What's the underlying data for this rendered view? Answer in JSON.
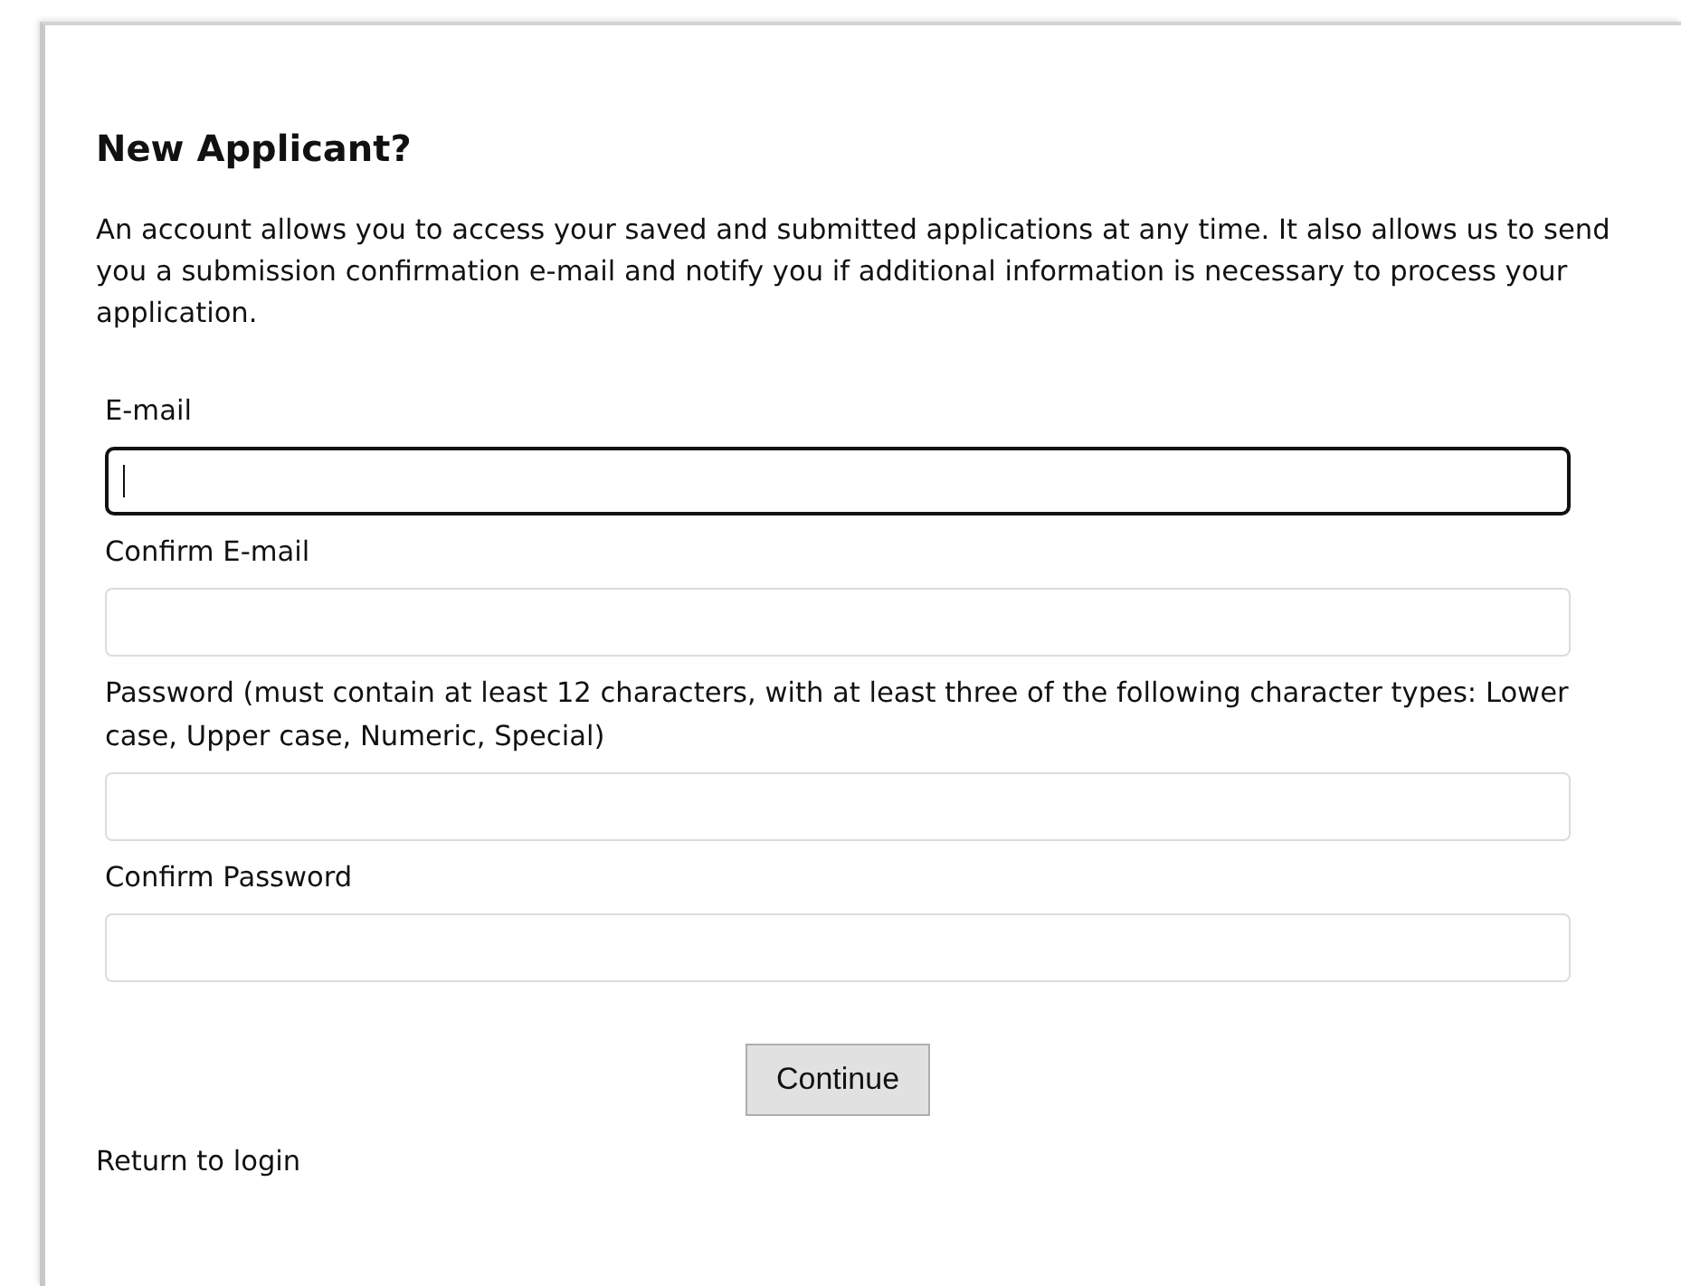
{
  "heading": "New Applicant?",
  "intro": "An account allows you to access your saved and submitted applications at any time. It also allows us to send you a submission confirmation e-mail and notify you if additional information is necessary to process your application.",
  "fields": [
    {
      "label": "E-mail",
      "focused": true
    },
    {
      "label": "Confirm E-mail",
      "focused": false
    },
    {
      "label": "Password (must contain at least 12 characters, with at least three of the following character types: Lower case, Upper case, Numeric, Special)",
      "focused": false
    },
    {
      "label": "Confirm Password",
      "focused": false
    }
  ],
  "button": "Continue",
  "link": "Return to login"
}
